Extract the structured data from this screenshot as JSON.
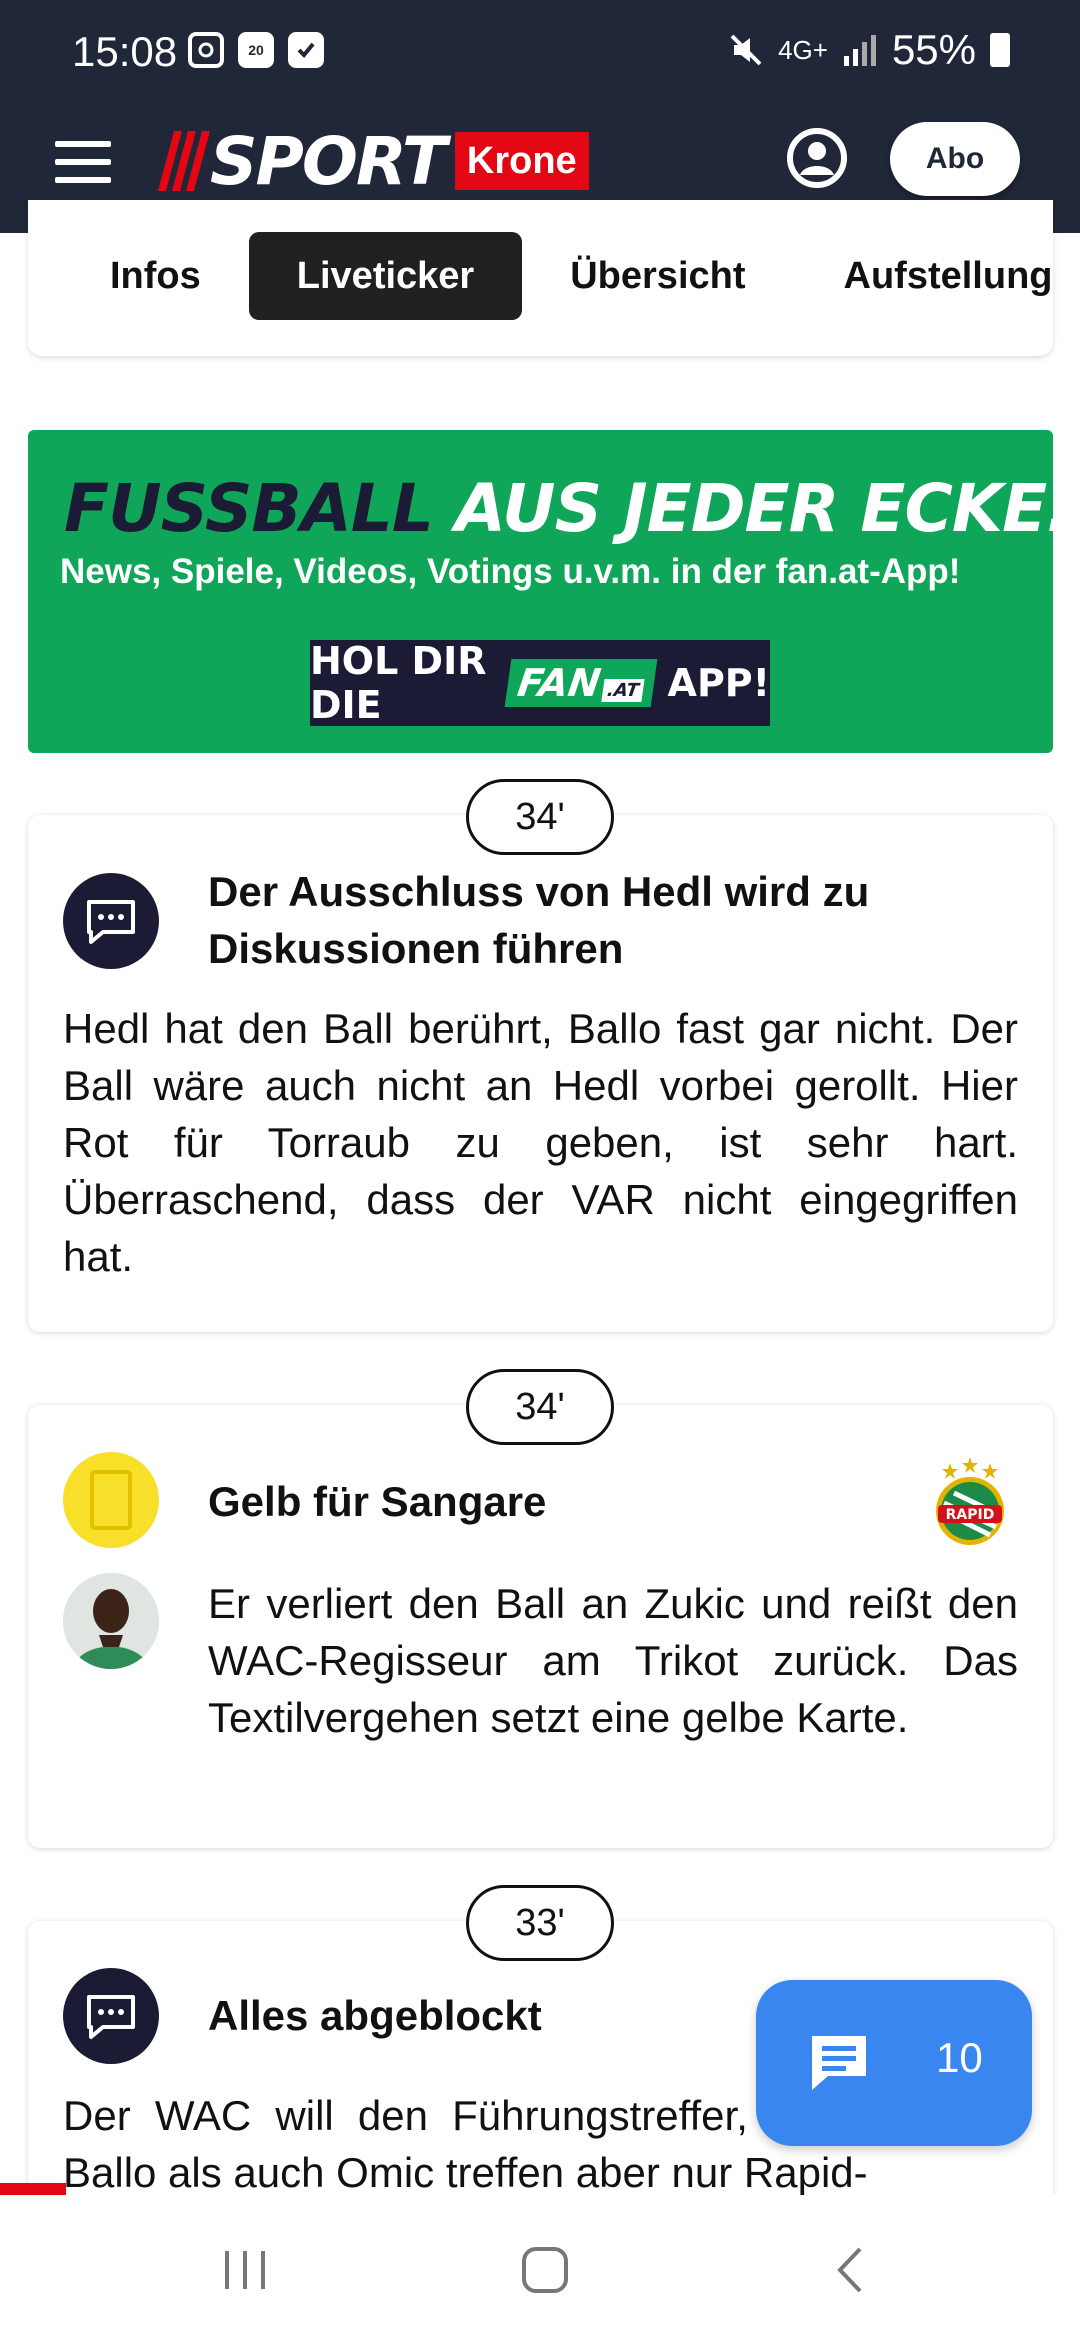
{
  "status_bar": {
    "time": "15:08",
    "calendar_day": "20",
    "network": "4G+",
    "battery": "55%"
  },
  "header": {
    "logo_sport": "SPORT",
    "logo_krone": "Krone",
    "abo_label": "Abo"
  },
  "tabs": [
    {
      "label": "Infos",
      "active": false
    },
    {
      "label": "Liveticker",
      "active": true
    },
    {
      "label": "Übersicht",
      "active": false
    },
    {
      "label": "Aufstellung",
      "active": false
    }
  ],
  "promo": {
    "headline_dark": "FUSSBALL",
    "headline_light": "AUS JEDER ECKE.",
    "subline": "News, Spiele, Videos, Votings u.v.m. in der fan.at-App!",
    "cta_prefix": "HOL DIR DIE",
    "cta_logo": "FAN",
    "cta_logo_suffix": ".AT",
    "cta_suffix": "APP!"
  },
  "ticker": [
    {
      "minute": "34'",
      "type": "comment",
      "title_line1": "Der Ausschluss von Hedl wird zu",
      "title_line2": "Diskussionen führen",
      "text": "Hedl hat den Ball berührt, Ballo fast gar nicht. Der Ball wäre auch nicht an Hedl vorbei gerollt. Hier Rot für Torraub zu geben, ist sehr hart. Überraschend, dass der VAR nicht eingegriffen hat."
    },
    {
      "minute": "34'",
      "type": "yellow-card",
      "title": "Gelb für Sangare",
      "team_logo_text": "RAPID",
      "text": "Er verliert den Ball an Zukic und reißt den WAC-Regisseur am Trikot zurück. Das Textilvergehen setzt eine gelbe Karte."
    },
    {
      "minute": "33'",
      "type": "comment",
      "title": "Alles abgeblockt",
      "text": "Der WAC will den Führungstreffer, doch sowohl Ballo als auch Omic treffen aber nur Rapid-"
    }
  ],
  "chat": {
    "count": "10"
  },
  "colors": {
    "header_bg": "#1f2739",
    "brand_red": "#e30613",
    "promo_green": "#0fa65a",
    "yellow_card": "#f8df2a",
    "chat_blue": "#3a86f0"
  }
}
